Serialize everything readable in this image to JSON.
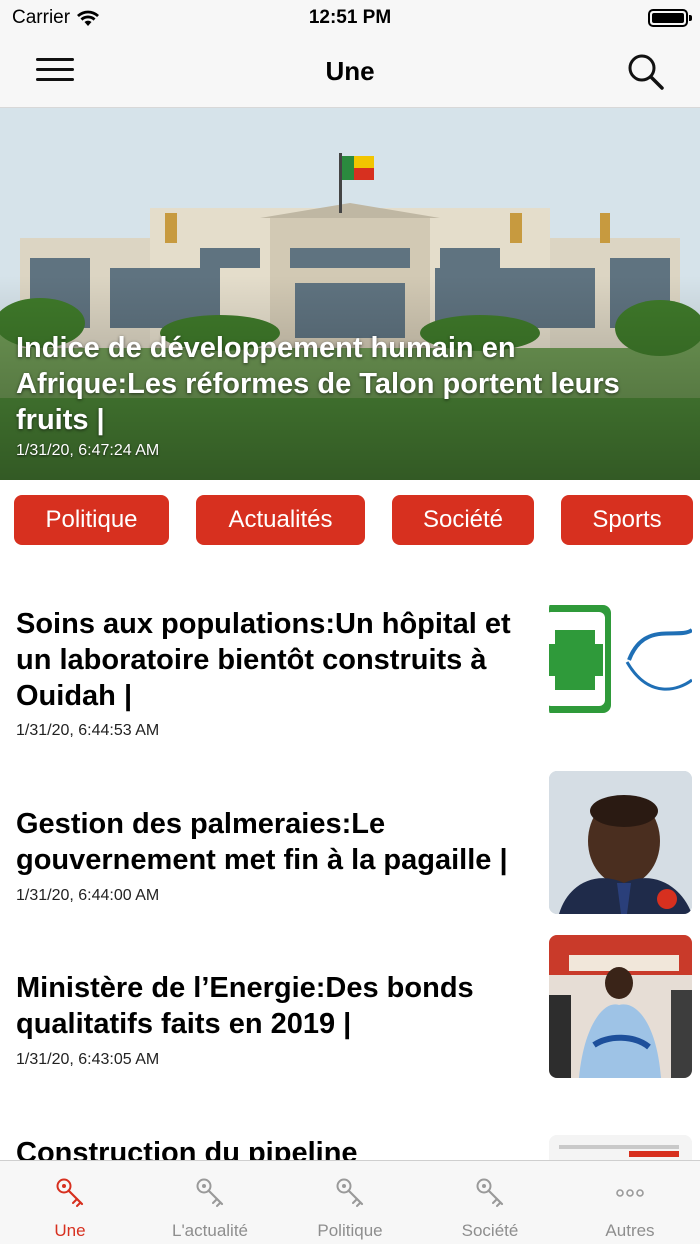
{
  "status_bar": {
    "carrier": "Carrier",
    "time": "12:51 PM"
  },
  "nav": {
    "title": "Une"
  },
  "hero": {
    "title": "Indice de développement humain en Afrique:Les réformes de Talon portent leurs fruits |",
    "timestamp": "1/31/20, 6:47:24 AM"
  },
  "categories": [
    "Politique",
    "Actualités",
    "Société",
    "Sports"
  ],
  "articles": [
    {
      "title": "Soins aux populations:Un hôpital et un laboratoire bientôt construits à Ouidah |",
      "timestamp": "1/31/20, 6:44:53 AM"
    },
    {
      "title": "Gestion des palmeraies:Le gouvernement met fin à la pagaille |",
      "timestamp": "1/31/20, 6:44:00 AM"
    },
    {
      "title": "Ministère de l’Energie:Des bonds qualitatifs faits en 2019 |",
      "timestamp": "1/31/20, 6:43:05 AM"
    },
    {
      "title": "Construction du pipeline"
    }
  ],
  "tabs": [
    {
      "label": "Une",
      "icon": "key-icon"
    },
    {
      "label": "L'actualité",
      "icon": "key-icon"
    },
    {
      "label": "Politique",
      "icon": "key-icon"
    },
    {
      "label": "Société",
      "icon": "key-icon"
    },
    {
      "label": "Autres",
      "icon": "more-icon"
    }
  ],
  "colors": {
    "accent": "#d7301f",
    "tab_inactive": "#8e8e8e",
    "bar_bg": "#f7f7f7"
  }
}
